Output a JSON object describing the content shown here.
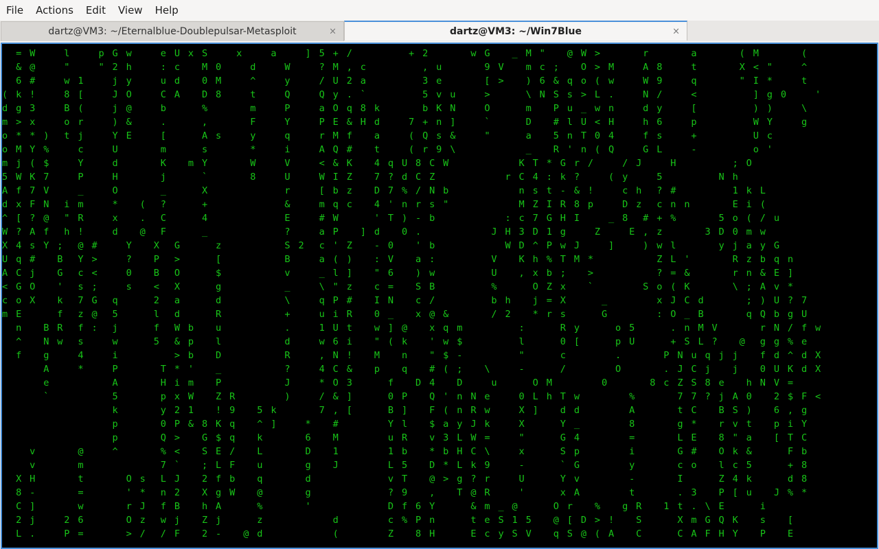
{
  "menubar": {
    "items": [
      "File",
      "Actions",
      "Edit",
      "View",
      "Help"
    ]
  },
  "tabs": [
    {
      "title": "dartz@VM3: ~/Eternalblue-Doublepulsar-Metasploit",
      "active": false,
      "close": "×"
    },
    {
      "title": "dartz@VM3: ~/Win7Blue",
      "active": true,
      "close": "×"
    }
  ],
  "terminal": {
    "foreground": "#18c418",
    "background": "#000000",
    "screen": "  = W    l    p G w    e U x S    x    a    ] 5 + /        + 2      w G   _ M \"   @ W >      r      a      ( M      (\n  & @    \"    \" 2 h    : c   M 0    d    W    ? M , c        , u      9 V   m c ;   O > M    A 8    t      X < \"    ^\n  6 #    w 1    j y    u d   0 M    ^    y    / U 2 a        3 e      [ >   ) 6 & q o ( w    W 9    q      \" I *    t\n( k !    8 [    J O    C A   D 8    t    Q    Q y . `        5 v u    >     \\ N S s > L .    N /    <        ] g 0    '\nd g 3    B (    j @    b     %      m    P    a O q 8 k      b K N    O     m   P u _ w n    d y    [        ) )    \\\nm > x    o r    ) &    .     ,      F    Y    P E & H d    7 + n ]    `     D   # l U < H    h 6    p        W Y    g\no * * )  t j    Y E    [     A s    y    q    r M f   a    ( Q s &    \"     a   5 n T 0 4    f s    +        U c\no M Y %    c    U      m     s      *    i    A Q #   t    ( r 9 \\          _   R ' n ( Q    G L    -        o '\nm j ( $    Y    d      K   m Y      W    V    < & K   4 q U 8 C W          K T * G r /    / J    H        ; O\n5 W K 7    P    H      j     `      8    U    W I Z   7 ? d C Z          r C 4 : k ?    ( y    5        N h\nA f 7 V    _    O      _     X           r    [ b z   D 7 % / N b          n s t - & !    c h  ? #        1 k L\nd x F N  i m    *   (  ?     +           &    m q c   4 ' n r s \"          M Z I R 8 p    D z  c n n      E i (\n^ [ ? @  \" R    x   .  C     4           E    # W     ' T ) - b          : c 7 G H I    _ 8  # + %      5 o ( / u\nW ? A f  h !    d   @  F     _           ?    a P   ] d   0 .          J H 3 D 1 g    Z    E , z      3 D 0 m w\nX 4 s Y ;  @ #    Y   X  G     z         S 2  c ' Z   - 0   ' b          W D ^ P w J    ]    ) w l      y j a y G\nU q #   B  Y >    ?   P  >     [         B    a ( )   : V   a :        V   K h % T M *         Z L '      R z b q n\nA C j   G  c <    0   B  O     $         v    _ l ]   \" 6   ) w        U   , x b ;   >         ? = &      r n & E ]\n< G O   '  s ;    s   <  X     g         _    \\ \" z   c =   S B        %     O Z x   `       S o ( K      \\ ; A v *\nc o X   k  7 G  q     2  a     d         \\    q P #   I N   c /        b h   j = X     _       x J C d      ; ) U ? 7\nm E     f  z @  5     l  d     R         +    u i R   0 _   x @ &      / 2   * r s     G       : O _ B      q Q b g U\n  n   B R  f :  j     f  W b   u         .    1 U t   w ] @   x q m        :     R y     o 5     . n M V      r N / f w\n  ^   N w  s    w     5  & p   l         d    w 6 i   \" ( k   ' w $        l     0 [     p U     + S L ?   @  g g % e\n  f   g    4    i        > b   D         R    , N !   M   n   \" $ -        \"     c       .      P N u q j j   f d ^ d X\n      A    *    P      T * '   _         ?    4 C &   p   q   # ( ;   \\    -     /       O      . J C j   j   0 U K d X\n      e         A      H i m   P         J    * O 3     f   D 4   D    u     O M       0      8 c Z S 8 e   h N V =\n      `         5      p x W   Z R       )    / & ]     0 P   Q ' n N e    0 L h T w       %      7 7 ? j A 0   2 $ F <\n                k      y 2 1   ! 9   5 k      7 , [     B ]   F ( n R w    X ]   d d       A      t C   B S )   6 , g\n                p      0 P & 8 K q   ^ ]    *   #       Y l   $ a y J k    X     Y _       8      g *   r v t   p i Y\n                p      Q >   G $ q   k      6   M       u R   v 3 L W =    \"     G 4       =      L E   8 \" a   [ T C\n    v      @    ^      % <   S E /   L      D   1       1 b   * b H C \\    x     S p       i      G #   O k &     F b\n    v      m           7 `   ; L F   u      g   J       L 5   D * L k 9    -     ` G       y      c o   l c 5     + 8\n  X H      t      O s  L J   2 f b   q      d           v T   @ > g ? r    U     Y v       -      I     Z 4 k     d 8\n  8 -      =      ' *  n 2   X g W   @      g           ? 9   ,   T @ R    '     x A       t      . 3   P [ u   J % *\n  C ]      w      r J  f B   h A     %      '           D f 6 Y     & m _ @     O r   %   g R   1 t . \\ E     i\n  2 j    2 6      O z  w j   Z j     z          d       c % P n     t e S 1 5   @ [ D > !   S     X m G Q K   s   [\n  L .    P =      > /  / F   2 -   @ d          (       Z   8 H     E c y S V   q S @ ( A   C     C A F H Y   P   E"
  }
}
